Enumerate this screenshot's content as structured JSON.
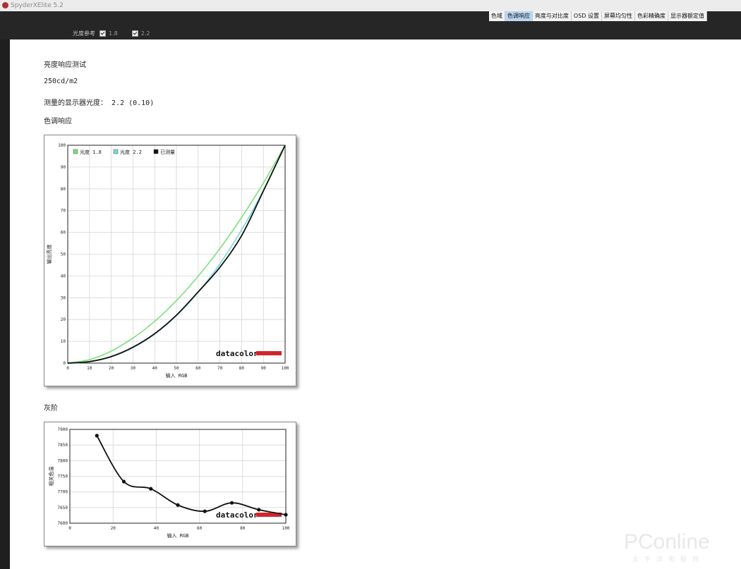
{
  "app": {
    "title": "SpyderXElite 5.2"
  },
  "tabs": [
    {
      "label": "色域",
      "active": false
    },
    {
      "label": "色调响应",
      "active": true
    },
    {
      "label": "亮度与对比度",
      "active": false
    },
    {
      "label": "OSD 设置",
      "active": false
    },
    {
      "label": "屏幕均匀性",
      "active": false
    },
    {
      "label": "色彩精确度",
      "active": false
    },
    {
      "label": "显示器额定值",
      "active": false
    }
  ],
  "toolbar": {
    "gamma_ref_label": "光度参考",
    "gamma_1": "1.8",
    "gamma_2": "2.2"
  },
  "report": {
    "heading": "亮度响应测试",
    "luminance": "250cd/m2",
    "measured_gamma": "测量的显示器光度： 2.2 (0.10)",
    "tone_response_title": "色调响应",
    "gray_title": "灰阶"
  },
  "logo_text": "datacolor",
  "watermark": {
    "text": "PConline",
    "sub": "太平洋电脑网"
  },
  "chart_data": [
    {
      "type": "line",
      "xlabel": "输入 RGB",
      "ylabel": "输出亮度",
      "xlim": [
        0,
        100
      ],
      "ylim": [
        0,
        100
      ],
      "xticks": [
        0,
        10,
        20,
        30,
        40,
        50,
        60,
        70,
        80,
        90,
        100
      ],
      "yticks": [
        0,
        10,
        20,
        30,
        40,
        50,
        60,
        70,
        80,
        90,
        100
      ],
      "grid": true,
      "legend_position": "top-left",
      "series": [
        {
          "name": "光度 1.8",
          "color": "#7de07d",
          "x": [
            0,
            10,
            20,
            30,
            40,
            50,
            60,
            70,
            80,
            90,
            100
          ],
          "y": [
            0,
            1.6,
            5.5,
            11.5,
            19.2,
            28.7,
            39.9,
            52.6,
            66.9,
            82.7,
            100
          ]
        },
        {
          "name": "光度 2.2",
          "color": "#7ad9e0",
          "x": [
            0,
            10,
            20,
            30,
            40,
            50,
            60,
            70,
            80,
            90,
            100
          ],
          "y": [
            0,
            0.6,
            2.9,
            7.1,
            13.3,
            21.8,
            32.5,
            45.6,
            61.2,
            79.3,
            100
          ]
        },
        {
          "name": "已测量",
          "color": "#111111",
          "x": [
            0,
            10,
            20,
            30,
            40,
            50,
            60,
            70,
            80,
            90,
            100
          ],
          "y": [
            0,
            0.7,
            3.0,
            7.3,
            13.5,
            22.0,
            32.7,
            44.0,
            58.5,
            79.0,
            100
          ]
        }
      ]
    },
    {
      "type": "line",
      "xlabel": "输入 RGB",
      "ylabel": "相关色温",
      "xlim": [
        0,
        100
      ],
      "ylim": [
        7600,
        7900
      ],
      "xticks": [
        0,
        20,
        40,
        60,
        80,
        100
      ],
      "yticks": [
        7600,
        7650,
        7700,
        7750,
        7800,
        7850,
        7900
      ],
      "grid": true,
      "series": [
        {
          "name": "",
          "color": "#111111",
          "x": [
            12.5,
            25,
            37.5,
            50,
            62.5,
            75,
            87.5,
            100
          ],
          "y": [
            7880,
            7733,
            7710,
            7658,
            7638,
            7665,
            7643,
            7627
          ]
        }
      ]
    }
  ]
}
